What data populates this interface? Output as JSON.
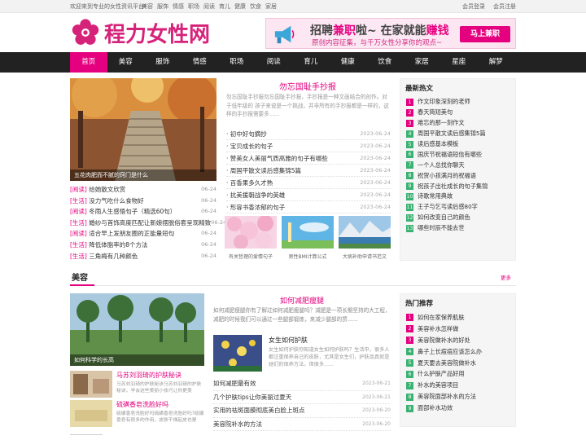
{
  "topbar": {
    "welcome": "欢迎来到专业的女性资讯平台!",
    "nav": [
      "美容",
      "服饰",
      "情感",
      "职场",
      "阅读",
      "育儿",
      "健康",
      "饮食",
      "家居"
    ],
    "login": "会员登录",
    "register": "会员注册"
  },
  "logo": {
    "text": "程力女性网",
    "color": "#d6237a"
  },
  "banner": {
    "line1_a": "招聘",
    "line1_em1": "兼职",
    "line1_b": "啦~ 在家就能",
    "line1_em2": "赚钱",
    "line2": "原创内容征集，与千万女性分享你的观点~",
    "button": "马上兼职"
  },
  "nav": {
    "active_color": "#e5007f",
    "items": [
      "首页",
      "美容",
      "服饰",
      "情感",
      "职场",
      "阅读",
      "育儿",
      "健康",
      "饮食",
      "家居",
      "星座",
      "解梦"
    ]
  },
  "hero": {
    "caption": "五花肉肥而不腻的窍门是什么"
  },
  "left_list": [
    {
      "cat": "[阅读]",
      "title": "给她散文欣赏",
      "date": "06-24"
    },
    {
      "cat": "[生活]",
      "title": "没力气吃什么食物好",
      "date": "06-24"
    },
    {
      "cat": "[阅读]",
      "title": "冬雨人生感悟句子（精选60句）",
      "date": "06-24"
    },
    {
      "cat": "[生活]",
      "title": "婚纱与首饰高度匹配让新娘摆脱俗套呈现精致",
      "date": "06-24"
    },
    {
      "cat": "[阅读]",
      "title": "适合早上发朋友圈的正能量短句",
      "date": "06-24"
    },
    {
      "cat": "[生活]",
      "title": "降低体脂率的8个方法",
      "date": "06-24"
    },
    {
      "cat": "[生活]",
      "title": "三角梅有几种颜色",
      "date": "06-24"
    }
  ],
  "feature": {
    "title": "勿忘国耻手抄报",
    "desc": "勿忘国耻手抄报勿忘国耻手抄报，手抄报是一种文画结合的创作。对于低年级的 孩子来说是一个挑战，并非所有的手抄报都是一样的，这样的手抄报需要多......",
    "list": [
      {
        "title": "初中好句摘抄",
        "date": "2023-06-24"
      },
      {
        "title": "宝贝成长的句子",
        "date": "2023-06-24"
      },
      {
        "title": "赞美女人美丽气质高雅的句子有哪些",
        "date": "2023-06-24"
      },
      {
        "title": "周国平散文读后感集锦5篇",
        "date": "2023-06-24"
      },
      {
        "title": "百香果多久才熟",
        "date": "2023-06-24"
      },
      {
        "title": "抗美援朝战争的英雄",
        "date": "2023-06-24"
      },
      {
        "title": "形容书香浓郁的句子",
        "date": "2023-06-24"
      }
    ],
    "thumbs": [
      "有关哲理的爱情句子",
      "男性BMI计算公式",
      "大病补助申请书范文"
    ]
  },
  "hot": {
    "title": "最新热文",
    "items": [
      "作文印象深刻的老师",
      "春天简短美句",
      "难忘的那一刻作文",
      "周国平散文读后感集锦5篇",
      "读后感基本模板",
      "国庆节祝福语短信有哪些",
      "一个人总找你聊天",
      "祝贺小孩满月的祝福语",
      "祝孩子出社成长的句子集锦",
      "诗歌常用典故",
      "王子与乞丐读后感80字",
      "如何改变自己的颜色",
      "哪些时辰不能去世"
    ],
    "num_colors": [
      "#e5007f",
      "#e5007f",
      "#e5007f",
      "#3bb273",
      "#3bb273",
      "#3bb273",
      "#3bb273",
      "#3bb273",
      "#3bb273",
      "#3bb273",
      "#3bb273",
      "#3bb273",
      "#3bb273"
    ]
  },
  "beauty": {
    "title": "美容",
    "more": "更多",
    "hero_caption": "如何科学的长高",
    "small": [
      {
        "title": "马苏刘羽琦的护肤秘诀",
        "desc": "马苏刘羽琦的护肤秘诀马苏刘羽琦的护肤秘诀。学会这些美丽小技巧让你更美"
      },
      {
        "title": "硫磺香皂洗脸好吗",
        "desc": "硫磺香皂洗脸好吗硫磺香皂洗脸好吗?硫磺香皂有很多的作用，皮肤干燥起皮也是"
      }
    ],
    "feature_title": "如何减肥瘦腿",
    "feature_desc": "如何减肥瘦腿你有了解过如何减肥瘦腿吗？减肥是一项长期坚持的大工程，减肥的时候我们可以通过一些腿部锻炼，来减少腿部的赘......",
    "mid_title": "女生如何护肤",
    "mid_desc": "女生如何护肤你知道女生如何护肤吗？生活中，很多人都注重保养自己的皮肤，尤其是女生们，护肤品真就是她们的保养方法，但很多......",
    "list": [
      {
        "title": "如何减肥最有效",
        "date": "2023-06-21"
      },
      {
        "title": "几个护肤tips让你美丽过夏天",
        "date": "2023-06-21"
      },
      {
        "title": "实用的祛斑面膜彻底美白脸上斑点",
        "date": "2023-06-20"
      },
      {
        "title": "美容院补水的方法",
        "date": "2023-06-20"
      }
    ]
  },
  "recommend": {
    "title": "热门推荐",
    "items": [
      "如何在家保养肌肤",
      "美容补水怎样做",
      "美容院做补水的好处",
      "鼻子上长痘痘应该怎么办",
      "夏天要去美容院做补水",
      "什么护肤产品好用",
      "补水的美容项目",
      "美容院面部补水的方法",
      "面部补水功效"
    ],
    "num_colors": [
      "#e5007f",
      "#e5007f",
      "#e5007f",
      "#3bb273",
      "#3bb273",
      "#3bb273",
      "#3bb273",
      "#3bb273",
      "#3bb273"
    ]
  }
}
